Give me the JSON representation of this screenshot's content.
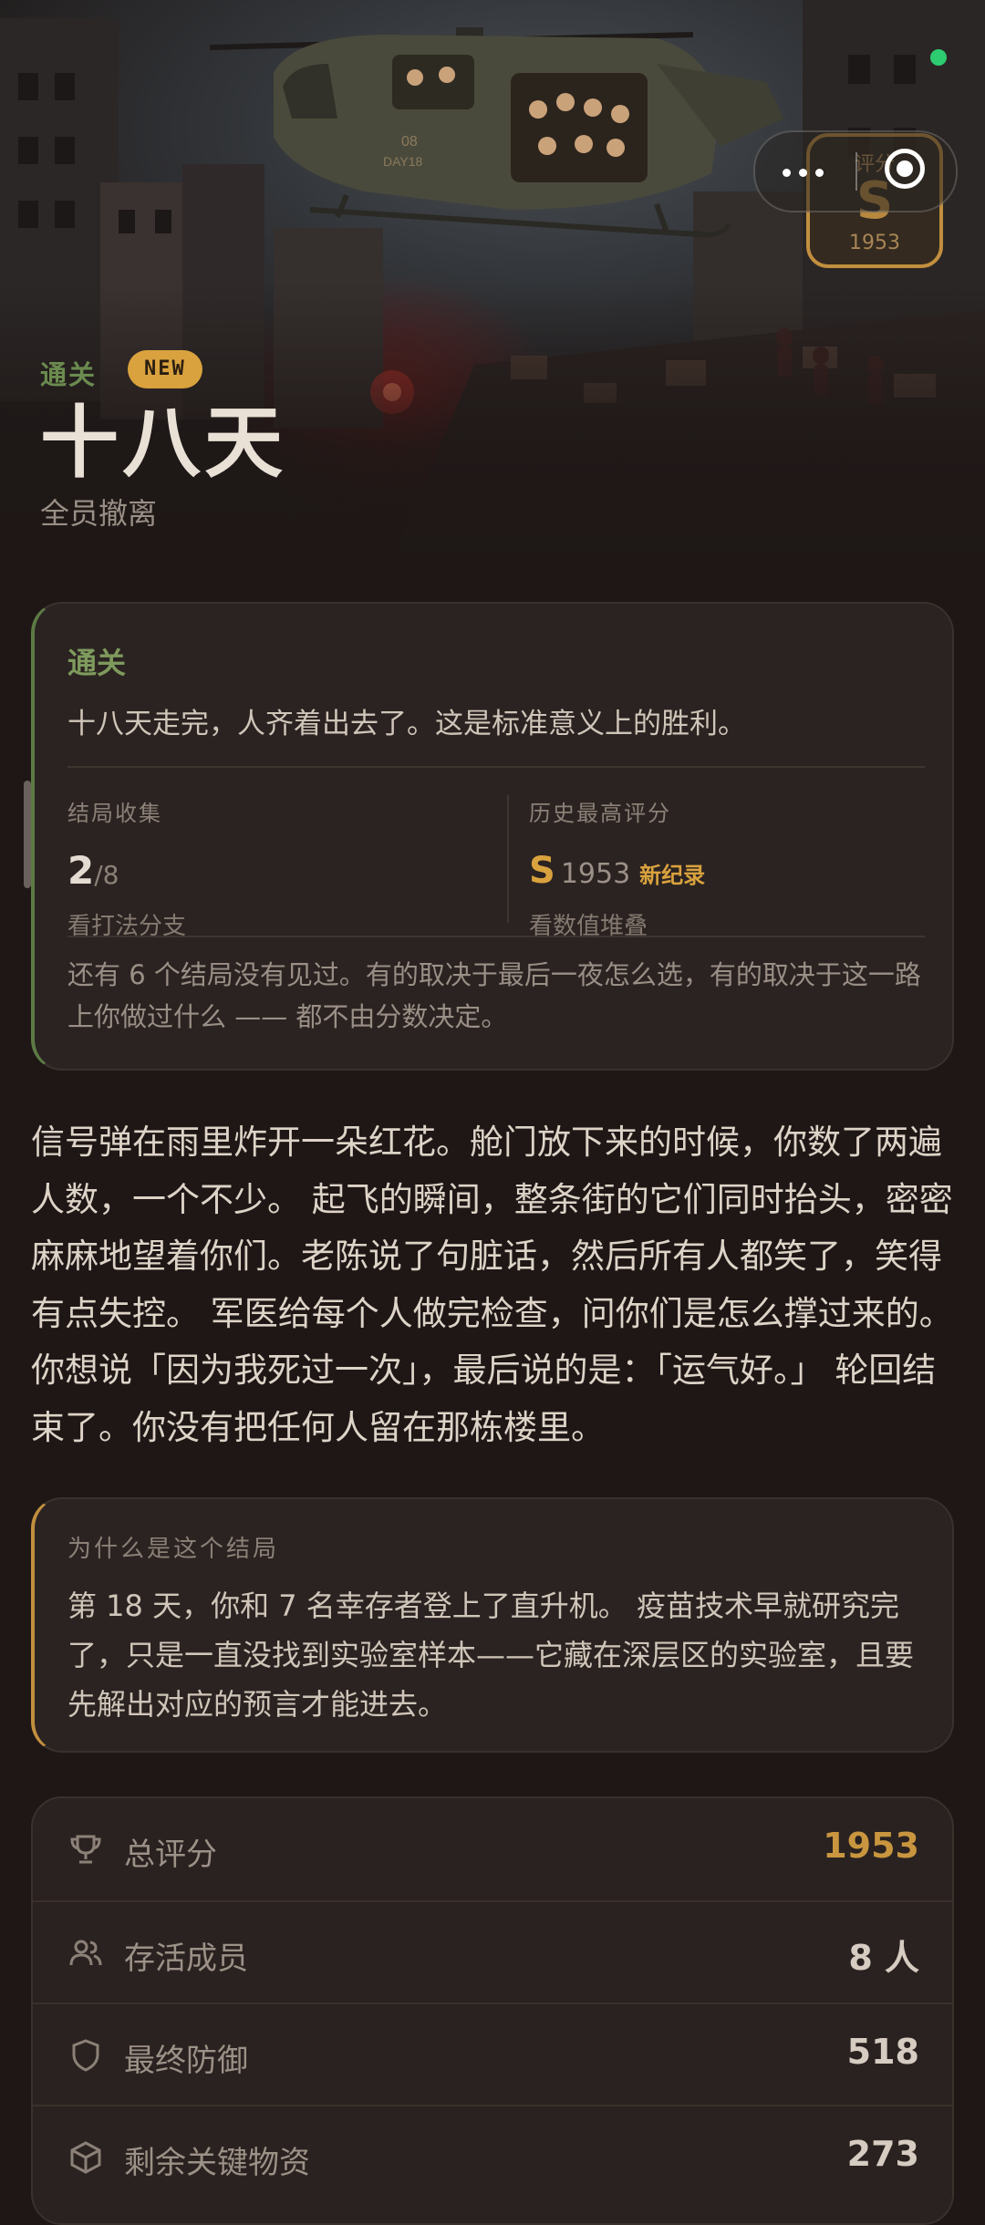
{
  "colors": {
    "background": "#1e1716",
    "accent_gold": "#d9a23e",
    "accent_green": "#6b8b4f",
    "status_dot": "#2ecc71"
  },
  "hero": {
    "helicopter_marking_1": "08",
    "helicopter_marking_2": "DAY18",
    "grade_badge": {
      "label": "评分",
      "grade": "S",
      "score": "1953"
    },
    "tag_clear": "通关",
    "tag_new": "NEW",
    "title": "十八天",
    "subtitle": "全员撤离"
  },
  "result_card": {
    "label": "通关",
    "description": "十八天走完，人齐着出去了。这是标准意义上的胜利。",
    "endings": {
      "header": "结局收集",
      "value": "2",
      "total": "8",
      "sub": "看打法分支"
    },
    "best_score": {
      "header": "历史最高评分",
      "grade": "S",
      "score": "1953",
      "new_record": "新纪录",
      "sub": "看数值堆叠"
    },
    "note": "还有 6 个结局没有见过。有的取决于最后一夜怎么选，有的取决于这一路上你做过什么 —— 都不由分数决定。"
  },
  "story": "信号弹在雨里炸开一朵红花。舱门放下来的时候，你数了两遍人数，一个不少。 起飞的瞬间，整条街的它们同时抬头，密密麻麻地望着你们。老陈说了句脏话，然后所有人都笑了，笑得有点失控。 军医给每个人做完检查，问你们是怎么撑过来的。 你想说「因为我死过一次」，最后说的是：「运气好。」 轮回结束了。你没有把任何人留在那栋楼里。",
  "why_card": {
    "label": "为什么是这个结局",
    "text": "第 18 天，你和 7 名幸存者登上了直升机。 疫苗技术早就研究完了，只是一直没找到实验室样本——它藏在深层区的实验室，且要先解出对应的预言才能进去。"
  },
  "stats": [
    {
      "icon": "trophy-icon",
      "label": "总评分",
      "value": "1953"
    },
    {
      "icon": "users-icon",
      "label": "存活成员",
      "value": "8 人"
    },
    {
      "icon": "shield-icon",
      "label": "最终防御",
      "value": "518"
    },
    {
      "icon": "box-icon",
      "label": "剩余关键物资",
      "value": "273"
    }
  ]
}
